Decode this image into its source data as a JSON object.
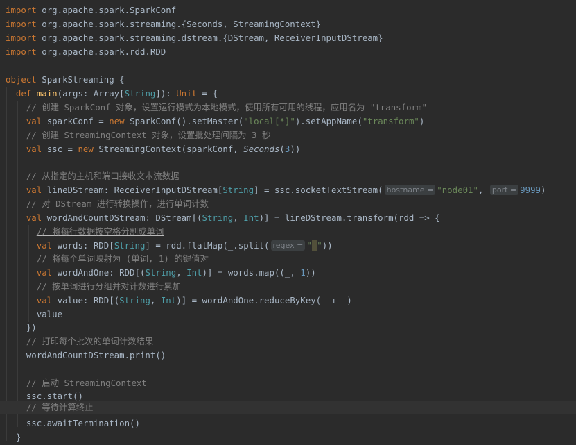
{
  "code": {
    "import1_kw": "import",
    "import1": "org.apache.spark.SparkConf",
    "import2_kw": "import",
    "import2a": "org.apache.spark.streaming.{Seconds, ",
    "import2b": "StreamingContext}",
    "import3_kw": "import",
    "import3": "org.apache.spark.streaming.dstream.{DStream, ReceiverInputDStream}",
    "import4_kw": "import",
    "import4": "org.apache.spark.rdd.RDD",
    "object_kw": "object",
    "object_name": "SparkStreaming {",
    "def_kw": "def",
    "main_name": "main",
    "main_sig_a": "(args: Array[",
    "string_t": "String",
    "main_sig_b": "]): ",
    "unit_t": "Unit",
    "main_sig_c": " = {",
    "comment1": "// 创建 SparkConf 对象，设置运行模式为本地模式，使用所有可用的线程，应用名为 \"transform\"",
    "val1_kw": "val",
    "val1_a": "sparkConf = ",
    "new1_kw": "new",
    "val1_b": "SparkConf().setMaster(",
    "val1_str1": "\"local[*]\"",
    "val1_c": ").setAppName(",
    "val1_str2": "\"transform\"",
    "val1_d": ")",
    "comment2": "// 创建 StreamingContext 对象，设置批处理间隔为 3 秒",
    "val2_kw": "val",
    "val2_a": "ssc = ",
    "new2_kw": "new",
    "val2_b": "StreamingContext(sparkConf, ",
    "val2_seconds": "Seconds",
    "val2_c": "(",
    "val2_num": "3",
    "val2_d": "))",
    "comment3": "// 从指定的主机和端口接收文本流数据",
    "val3_kw": "val",
    "val3_a": "lineDStream: ReceiverInputDStream[",
    "val3_string": "String",
    "val3_b": "] = ssc.socketTextStream(",
    "hint_hostname": "hostname =",
    "val3_str": "\"node01\"",
    "val3_comma": ",",
    "hint_port": "port =",
    "val3_num": "9999",
    "val3_c": ")",
    "comment4": "// 对 DStream 进行转换操作，进行单词计数",
    "val4_kw": "val",
    "val4_a": "wordAndCountDStream: DStream[(",
    "val4_string": "String",
    "val4_comma": ", ",
    "val4_int": "Int",
    "val4_b": ")] = lineDStream.transform(rdd => {",
    "comment5": "// 将每行数据按空格分割成单词",
    "val5_kw": "val",
    "val5_a": "words: RDD[",
    "val5_string": "String",
    "val5_b": "] = rdd.flatMap(_.split(",
    "hint_regex": "regex =",
    "val5_q1": "\"",
    "val5_space": " ",
    "val5_q2": "\"",
    "val5_c": "))",
    "comment6": "// 将每个单词映射为 (单词, 1) 的键值对",
    "val6_kw": "val",
    "val6_a": "wordAndOne: RDD[(",
    "val6_string": "String",
    "val6_comma": ", ",
    "val6_int": "Int",
    "val6_b": ")] = words.map((_, ",
    "val6_num": "1",
    "val6_c": "))",
    "comment7": "// 按单词进行分组并对计数进行累加",
    "val7_kw": "val",
    "val7_a": "value: RDD[(",
    "val7_string": "String",
    "val7_comma": ", ",
    "val7_int": "Int",
    "val7_b": ")] = wordAndOne.reduceByKey(_ + _)",
    "value_line": "value",
    "close_transform": "})",
    "comment8": "// 打印每个批次的单词计数结果",
    "print_line": "wordAndCountDStream.print()",
    "comment9": "// 启动 StreamingContext",
    "start_line": "ssc.start()",
    "comment10": "// 等待计算终止",
    "await_line": "ssc.awaitTermination()",
    "close_main": "}"
  },
  "colors": {
    "background": "#2b2b2b",
    "keyword": "#cc7832",
    "string": "#6a8759",
    "number": "#6897bb",
    "comment": "#808080",
    "type": "#4e9ea8",
    "function": "#ffc66d",
    "text": "#a9b7c6"
  }
}
